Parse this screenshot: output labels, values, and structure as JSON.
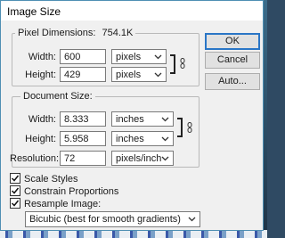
{
  "dialog": {
    "title": "Image Size",
    "pixel_dimensions": {
      "label": "Pixel Dimensions:",
      "size": "754.1K",
      "width": {
        "label": "Width:",
        "value": "600",
        "unit": "pixels"
      },
      "height": {
        "label": "Height:",
        "value": "429",
        "unit": "pixels"
      }
    },
    "document_size": {
      "label": "Document Size:",
      "width": {
        "label": "Width:",
        "value": "8.333",
        "unit": "inches"
      },
      "height": {
        "label": "Height:",
        "value": "5.958",
        "unit": "inches"
      },
      "resolution": {
        "label": "Resolution:",
        "value": "72",
        "unit": "pixels/inch"
      }
    },
    "buttons": {
      "ok": "OK",
      "cancel": "Cancel",
      "auto": "Auto..."
    },
    "options": {
      "scale_styles": {
        "label": "Scale Styles",
        "checked": true
      },
      "constrain_proportions": {
        "label": "Constrain Proportions",
        "checked": true
      },
      "resample_image": {
        "label": "Resample Image:",
        "checked": true
      }
    },
    "resample_method": "Bicubic (best for smooth gradients)"
  }
}
